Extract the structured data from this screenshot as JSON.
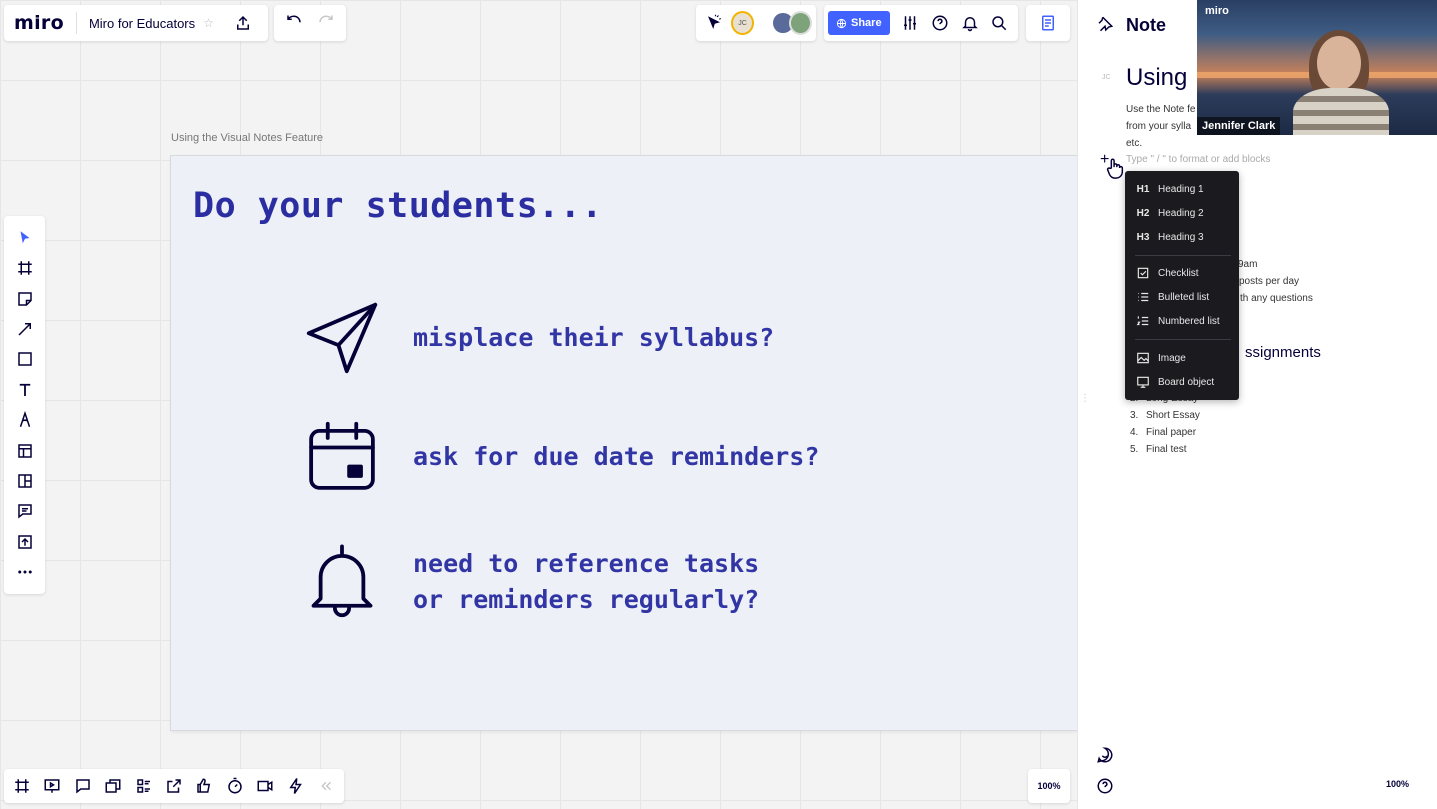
{
  "app": {
    "logo": "miro",
    "board_title": "Miro for Educators",
    "star": "☆"
  },
  "toolbar": {
    "share_label": "Share",
    "avatar1_initials": "JC"
  },
  "canvas": {
    "frame_label": "Using the Visual Notes Feature",
    "slide": {
      "title": "Do your students...",
      "items": [
        {
          "icon": "paper-plane-icon",
          "line1": "misplace their syllabus?",
          "line2": ""
        },
        {
          "icon": "calendar-icon",
          "line1": "ask for due date reminders?",
          "line2": ""
        },
        {
          "icon": "bell-icon",
          "line1": "need to reference tasks",
          "line2": "or reminders regularly?"
        }
      ]
    },
    "zoom": "100%"
  },
  "note_panel": {
    "title": "Note",
    "author_initials": "JC",
    "heading": "Using",
    "description": "Use the Note f... from your sylla... etc.",
    "desc_line1": "Use the Note fe",
    "desc_line2": "from your sylla",
    "desc_line3": "etc.",
    "placeholder": "Type \" / \" to format or add blocks",
    "partial_line1": "9am",
    "partial_line2": "posts per day",
    "partial_line3": "th any questions",
    "section_heading": "ssignments",
    "list": [
      {
        "n": "2.",
        "text": "Long Essay"
      },
      {
        "n": "3.",
        "text": "Short Essay"
      },
      {
        "n": "4.",
        "text": "Final paper"
      },
      {
        "n": "5.",
        "text": "Final test"
      }
    ],
    "zoom": "100%"
  },
  "block_menu": {
    "items": [
      {
        "icon": "H1",
        "label": "Heading 1"
      },
      {
        "icon": "H2",
        "label": "Heading 2"
      },
      {
        "icon": "H3",
        "label": "Heading 3"
      },
      {
        "icon": "checklist-icon",
        "label": "Checklist"
      },
      {
        "icon": "bulleted-list-icon",
        "label": "Bulleted list"
      },
      {
        "icon": "numbered-list-icon",
        "label": "Numbered list"
      },
      {
        "icon": "image-icon",
        "label": "Image"
      },
      {
        "icon": "board-object-icon",
        "label": "Board object"
      }
    ]
  },
  "video": {
    "logo": "miro",
    "participant_name": "Jennifer Clark"
  },
  "colors": {
    "accent": "#4262ff",
    "slide_text": "#2b2ea0",
    "menu_bg": "#1a1a1f"
  }
}
